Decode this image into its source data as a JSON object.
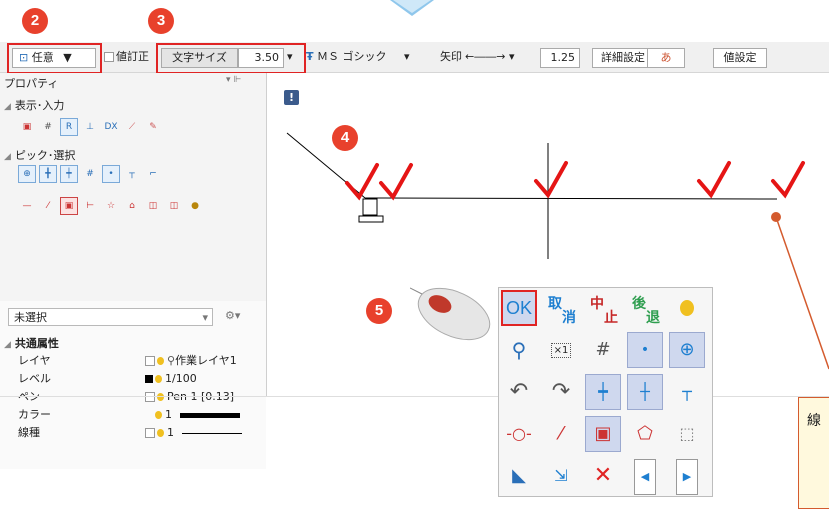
{
  "toolbar": {
    "mode_label": "任意",
    "correct_label": "値訂正",
    "textsize_label": "文字サイズ",
    "textsize_value": "3.50",
    "font_label": "ＭＳ ゴシック",
    "arrow_label": "矢印",
    "arrow_value": "1.25",
    "detail_button": "詳細設定",
    "font_icon_label": "あ",
    "value_button": "値設定"
  },
  "badges": {
    "b2": "2",
    "b3": "3",
    "b4": "4",
    "b5": "5"
  },
  "panel": {
    "title": "プロパティ",
    "section_display": "表示･入力",
    "section_pick": "ピック･選択",
    "selection_value": "未選択",
    "common_header": "共通属性",
    "rows": [
      {
        "label": "レイヤ",
        "value": "作業レイヤ1"
      },
      {
        "label": "レベル",
        "value": "1/100"
      },
      {
        "label": "ペン",
        "value": "Pen 1 [0.13]"
      },
      {
        "label": "カラー",
        "value": "1"
      },
      {
        "label": "線種",
        "value": "1"
      }
    ]
  },
  "palette": {
    "ok": "OK",
    "cancel_top": "取",
    "cancel_bottom": "消",
    "stop_top": "中",
    "stop_bottom": "止",
    "back_top": "後",
    "back_bottom": "退",
    "x1_label": "×1"
  },
  "note": {
    "text": "線"
  },
  "colors": {
    "accent_red": "#e02424",
    "badge": "#e8412c",
    "check": "#e51515",
    "leader": "#d45b2e",
    "ok_blue": "#1e7fd0"
  }
}
